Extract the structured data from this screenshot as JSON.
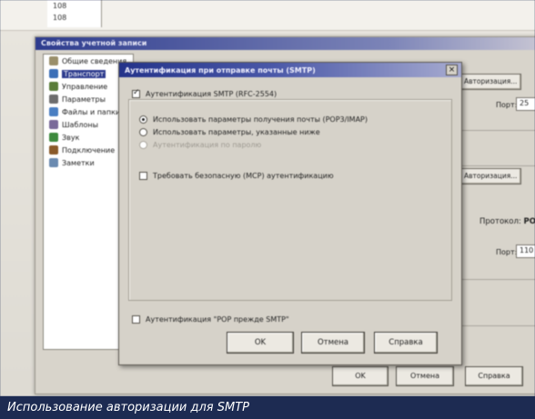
{
  "background": {
    "top_cell_values": [
      "108",
      "108"
    ]
  },
  "outer_window": {
    "title": "Свойства учетной записи",
    "tree_items": [
      {
        "label": "Общие сведения",
        "icon": "general-icon",
        "color": "#9a8f6a"
      },
      {
        "label": "Транспорт",
        "icon": "transport-icon",
        "color": "#3b6fb7",
        "selected": true
      },
      {
        "label": "Управление",
        "icon": "manage-icon",
        "color": "#5a7d3a"
      },
      {
        "label": "Параметры",
        "icon": "params-icon",
        "color": "#6d6d6d"
      },
      {
        "label": "Файлы и папки",
        "icon": "files-icon",
        "color": "#4a7ec2"
      },
      {
        "label": "Шаблоны",
        "icon": "templates-icon",
        "color": "#7a6a9a"
      },
      {
        "label": "Звук",
        "icon": "sound-icon",
        "color": "#3e8a3e"
      },
      {
        "label": "Подключение",
        "icon": "connection-icon",
        "color": "#8a5a2a"
      },
      {
        "label": "Заметки",
        "icon": "notes-icon",
        "color": "#6a8ab0"
      }
    ],
    "right": {
      "auth_button_1": "Авторизация...",
      "port_label_1": "Порт:",
      "port_value_1": "25",
      "auth_button_2": "Авторизация...",
      "protocol_label": "Протокол:",
      "protocol_value": "POP3",
      "port_label_2": "Порт:",
      "port_value_2": "110"
    },
    "buttons": {
      "ok": "OK",
      "cancel": "Отмена",
      "help": "Справка"
    }
  },
  "dialog": {
    "title": "Аутентификация при отправке почты (SMTP)",
    "close": "×",
    "smtp_auth_checkbox": "Аутентификация SMTP (RFC-2554)",
    "radio_use_pop": "Использовать параметры получения почты (POP3/IMAP)",
    "radio_use_below": "Использовать параметры, указанные ниже",
    "dim_option": "Аутентификация по паролю",
    "mcp_checkbox": "Требовать безопасную (MCP) аутентификацию",
    "pop_before_smtp_checkbox": "Аутентификация \"POP прежде SMTP\"",
    "buttons": {
      "ok": "OK",
      "cancel": "Отмена",
      "help": "Справка"
    }
  },
  "caption": "Использование авторизации для SMTP",
  "colors": {
    "title_bar": "#24338a",
    "caption_bg": "#1d2b52"
  }
}
